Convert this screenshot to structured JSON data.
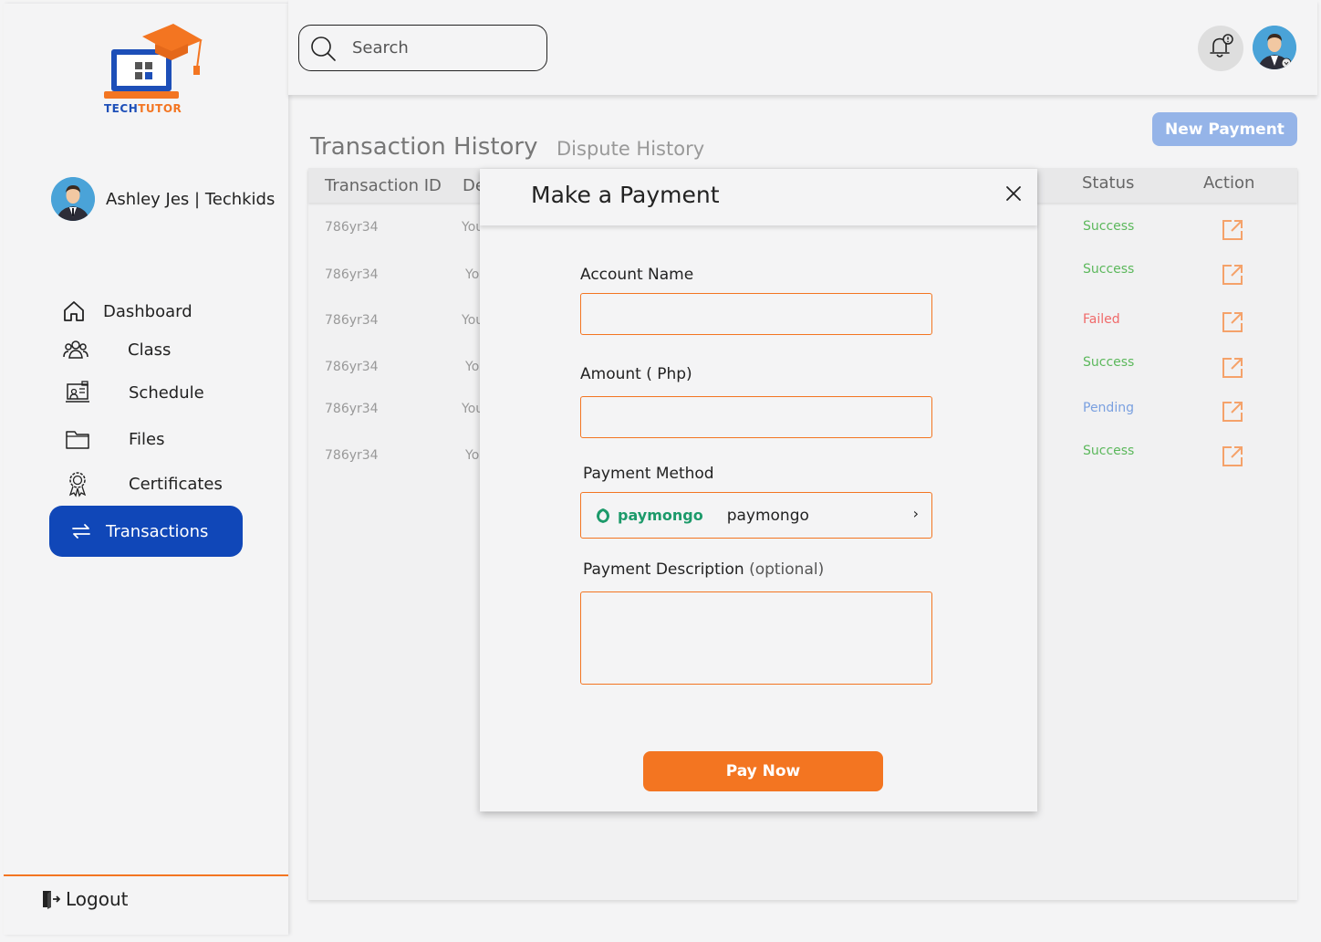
{
  "brand": {
    "name_part1": "TECH",
    "name_part2": "TUTOR",
    "primary_color": "#1047b8",
    "accent_color": "#f37521"
  },
  "profile": {
    "name": "Ashley Jes | Techkids"
  },
  "nav": {
    "items": [
      {
        "label": "Dashboard",
        "icon": "home-icon"
      },
      {
        "label": "Class",
        "icon": "users-icon"
      },
      {
        "label": "Schedule",
        "icon": "presentation-icon"
      },
      {
        "label": "Files",
        "icon": "folder-icon"
      },
      {
        "label": "Certificates",
        "icon": "award-icon"
      }
    ],
    "active": {
      "label": "Transactions",
      "icon": "swap-arrows-icon"
    },
    "logout": "Logout"
  },
  "search": {
    "placeholder": "Search"
  },
  "tabs": {
    "transaction_history": "Transaction History",
    "dispute_history": "Dispute History"
  },
  "new_payment_label": "New Payment",
  "table": {
    "columns": {
      "transaction_id": "Transaction ID",
      "description": "De",
      "status": "Status",
      "action": "Action"
    },
    "rows": [
      {
        "id": "786yr34",
        "desc": "You",
        "status": "Success",
        "status_color": "#5cb85c"
      },
      {
        "id": "786yr34",
        "desc": "Yo",
        "status": "Success",
        "status_color": "#5cb85c"
      },
      {
        "id": "786yr34",
        "desc": "You",
        "status": "Failed",
        "status_color": "#f06a6a"
      },
      {
        "id": "786yr34",
        "desc": "Yo",
        "status": "Success",
        "status_color": "#5cb85c"
      },
      {
        "id": "786yr34",
        "desc": "You",
        "status": "Pending",
        "status_color": "#7aa0e0"
      },
      {
        "id": "786yr34",
        "desc": "Yo",
        "status": "Success",
        "status_color": "#5cb85c"
      }
    ]
  },
  "modal": {
    "title": "Make a Payment",
    "account_name_label": "Account Name",
    "amount_label": "Amount ( Php)",
    "payment_method_label": "Payment Method",
    "payment_method": {
      "logo_text": "paymongo",
      "name": "paymongo",
      "chevron": "›"
    },
    "description_label": "Payment Description",
    "description_optional": "(optional)",
    "pay_now": "Pay Now"
  }
}
